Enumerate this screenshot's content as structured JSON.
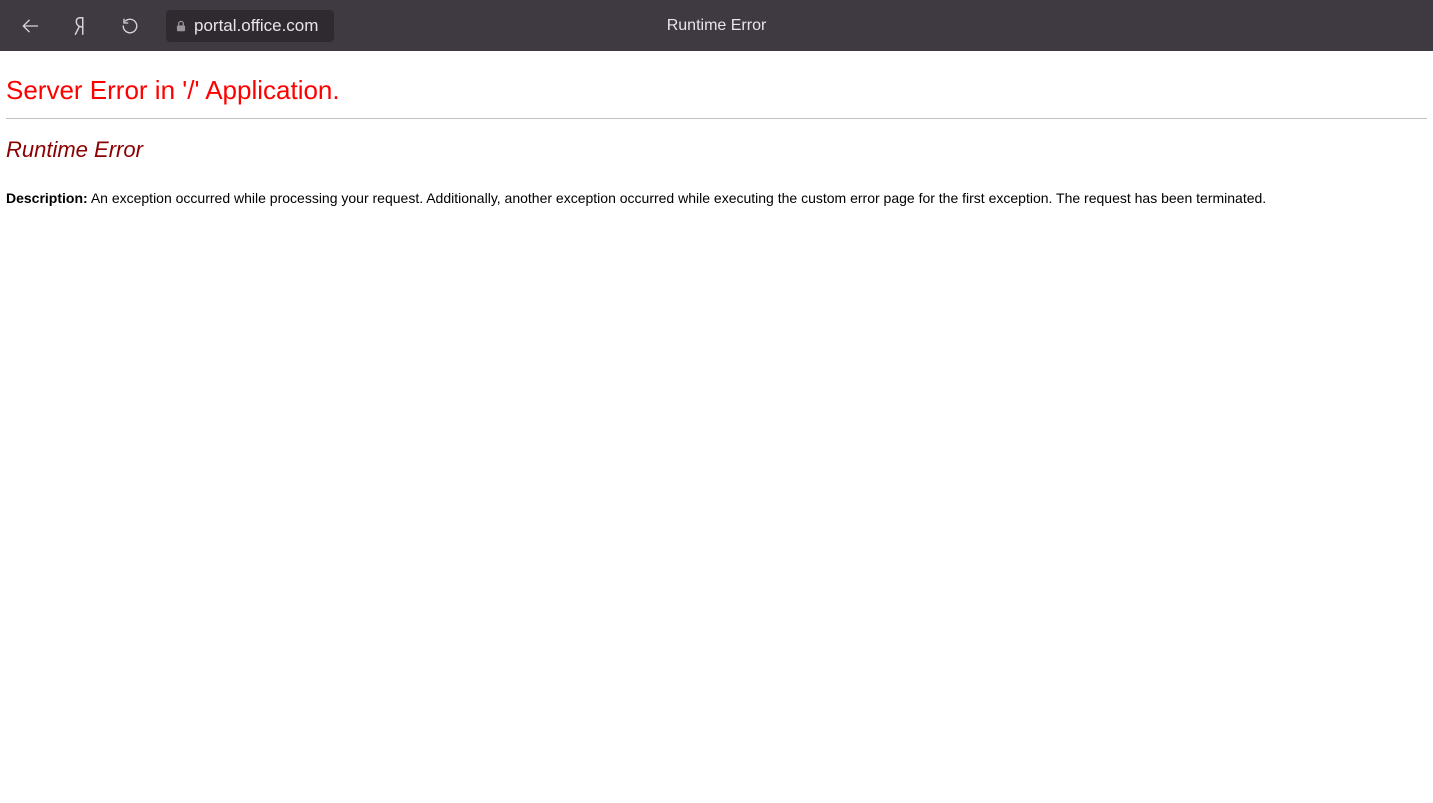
{
  "browser": {
    "url": "portal.office.com",
    "tab_title": "Runtime Error"
  },
  "page": {
    "server_error_heading": "Server Error in '/' Application.",
    "runtime_heading": "Runtime Error",
    "description_label": "Description:",
    "description_text": "An exception occurred while processing your request. Additionally, another exception occurred while executing the custom error page for the first exception. The request has been terminated."
  }
}
